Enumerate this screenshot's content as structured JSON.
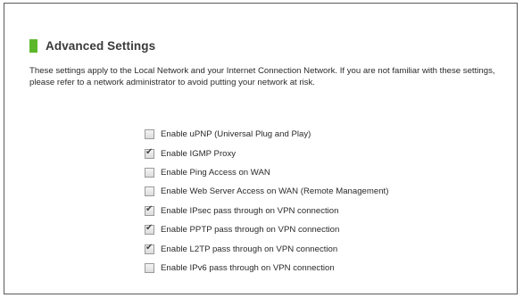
{
  "panel": {
    "title": "Advanced Settings",
    "description": "These settings apply to the Local Network and your Internet Connection Network.  If you are not familiar with these settings, please refer to a network administrator to avoid putting your network at risk."
  },
  "options": [
    {
      "label": "Enable uPNP (Universal Plug and Play)",
      "checked": false
    },
    {
      "label": "Enable IGMP Proxy",
      "checked": true
    },
    {
      "label": "Enable Ping Access on WAN",
      "checked": false
    },
    {
      "label": "Enable Web Server Access on WAN (Remote Management)",
      "checked": false
    },
    {
      "label": "Enable IPsec pass through on VPN connection",
      "checked": true
    },
    {
      "label": "Enable PPTP pass through on VPN connection",
      "checked": true
    },
    {
      "label": "Enable L2TP pass through on VPN connection",
      "checked": true
    },
    {
      "label": "Enable IPv6 pass through on VPN connection",
      "checked": false
    }
  ],
  "colors": {
    "title_marker": "#5cb82a",
    "border": "#5a5a5a"
  },
  "icons": {
    "title_marker": "green-square-icon",
    "checked": "checkmark-icon"
  }
}
